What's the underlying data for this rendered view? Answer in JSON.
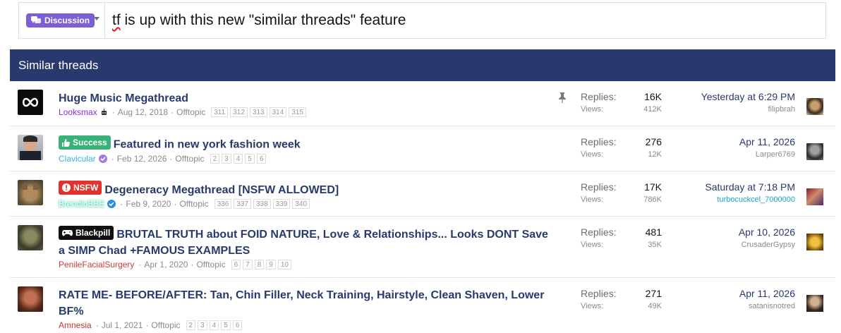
{
  "title_bar": {
    "prefix": "Discussion",
    "title_prefix_misspelled": "tf",
    "title_rest": " is up with this new \"similar threads\" feature"
  },
  "block": {
    "header": "Similar threads"
  },
  "threads": [
    {
      "label": "",
      "title": "Huge Music Megathread",
      "author": "Looksmax",
      "date": "Aug 12, 2018",
      "forum": "Offtopic",
      "pages": [
        "311",
        "312",
        "313",
        "314",
        "315"
      ],
      "replies_label": "Replies:",
      "replies": "16K",
      "views_label": "Views:",
      "views": "412K",
      "last_post": "Yesterday at 6:29 PM",
      "last_user": "filipbrah",
      "pinned": true
    },
    {
      "label": "Success",
      "title": "Featured in new york fashion week",
      "author": "Clavicular",
      "date": "Feb 12, 2026",
      "forum": "Offtopic",
      "pages": [
        "2",
        "3",
        "4",
        "5",
        "6"
      ],
      "replies_label": "Replies:",
      "replies": "276",
      "views_label": "Views:",
      "views": "12K",
      "last_post": "Apr 11, 2026",
      "last_user": "Larper6769"
    },
    {
      "label": "NSFW",
      "title": "Degeneracy Megathread [NSFW ALLOWED]",
      "author": "BrendioEEE",
      "date": "Feb 9, 2020",
      "forum": "Offtopic",
      "pages": [
        "336",
        "337",
        "338",
        "339",
        "340"
      ],
      "replies_label": "Replies:",
      "replies": "17K",
      "views_label": "Views:",
      "views": "786K",
      "last_post": "Saturday at 7:18 PM",
      "last_user": "turbocuckcel_7000000"
    },
    {
      "label": "Blackpill",
      "title": "BRUTAL TRUTH about FOID NATURE, Love & Relationships... Looks DONT Save a SIMP Chad +FAMOUS EXAMPLES",
      "author": "PenileFacialSurgery",
      "date": "Apr 1, 2020",
      "forum": "Offtopic",
      "pages": [
        "6",
        "7",
        "8",
        "9",
        "10"
      ],
      "replies_label": "Replies:",
      "replies": "481",
      "views_label": "Views:",
      "views": "35K",
      "last_post": "Apr 10, 2026",
      "last_user": "CrusaderGypsy"
    },
    {
      "label": "",
      "title": "RATE ME- BEFORE/AFTER: Tan, Chin Filler, Neck Training, Hairstyle, Clean Shaven, Lower BF%",
      "author": "Amnesia",
      "date": "Jul 1, 2021",
      "forum": "Offtopic",
      "pages": [
        "2",
        "3",
        "4",
        "5",
        "6"
      ],
      "replies_label": "Replies:",
      "replies": "271",
      "views_label": "Views:",
      "views": "49K",
      "last_post": "Apr 11, 2026",
      "last_user": "satanisnotred"
    }
  ],
  "colors": {
    "header_bg": "#283a6d",
    "prefix_bg": "#7c5fd6",
    "success": "#37b37a",
    "nsfw": "#e0322e",
    "blackpill": "#111111",
    "author_looksmax": "#8a2be2",
    "author_clavicular": "#3ab0e8",
    "author_penile": "#d23b3b",
    "author_amnesia": "#c0392b",
    "last_user_turbo": "#16a5c7"
  }
}
